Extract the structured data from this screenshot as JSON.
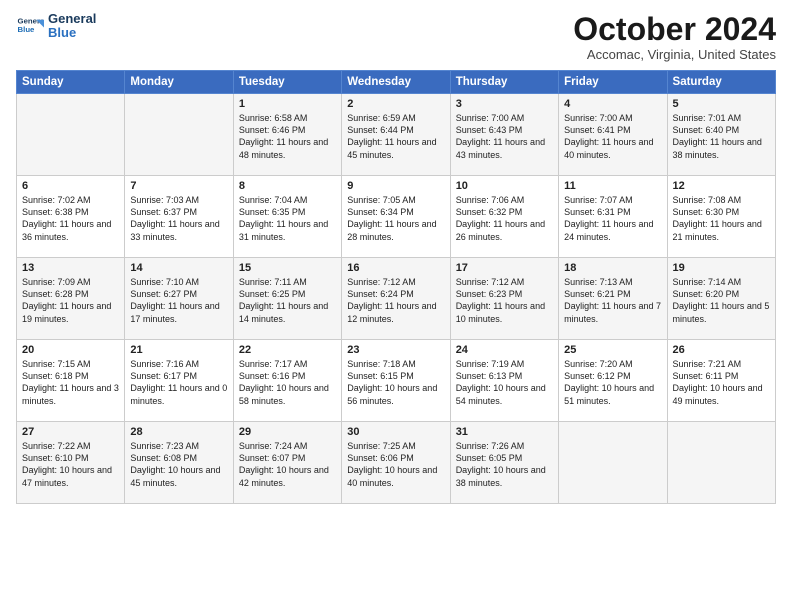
{
  "logo": {
    "line1": "General",
    "line2": "Blue"
  },
  "title": "October 2024",
  "subtitle": "Accomac, Virginia, United States",
  "days": [
    "Sunday",
    "Monday",
    "Tuesday",
    "Wednesday",
    "Thursday",
    "Friday",
    "Saturday"
  ],
  "weeks": [
    [
      {
        "day": "",
        "text": ""
      },
      {
        "day": "",
        "text": ""
      },
      {
        "day": "1",
        "text": "Sunrise: 6:58 AM\nSunset: 6:46 PM\nDaylight: 11 hours and 48 minutes."
      },
      {
        "day": "2",
        "text": "Sunrise: 6:59 AM\nSunset: 6:44 PM\nDaylight: 11 hours and 45 minutes."
      },
      {
        "day": "3",
        "text": "Sunrise: 7:00 AM\nSunset: 6:43 PM\nDaylight: 11 hours and 43 minutes."
      },
      {
        "day": "4",
        "text": "Sunrise: 7:00 AM\nSunset: 6:41 PM\nDaylight: 11 hours and 40 minutes."
      },
      {
        "day": "5",
        "text": "Sunrise: 7:01 AM\nSunset: 6:40 PM\nDaylight: 11 hours and 38 minutes."
      }
    ],
    [
      {
        "day": "6",
        "text": "Sunrise: 7:02 AM\nSunset: 6:38 PM\nDaylight: 11 hours and 36 minutes."
      },
      {
        "day": "7",
        "text": "Sunrise: 7:03 AM\nSunset: 6:37 PM\nDaylight: 11 hours and 33 minutes."
      },
      {
        "day": "8",
        "text": "Sunrise: 7:04 AM\nSunset: 6:35 PM\nDaylight: 11 hours and 31 minutes."
      },
      {
        "day": "9",
        "text": "Sunrise: 7:05 AM\nSunset: 6:34 PM\nDaylight: 11 hours and 28 minutes."
      },
      {
        "day": "10",
        "text": "Sunrise: 7:06 AM\nSunset: 6:32 PM\nDaylight: 11 hours and 26 minutes."
      },
      {
        "day": "11",
        "text": "Sunrise: 7:07 AM\nSunset: 6:31 PM\nDaylight: 11 hours and 24 minutes."
      },
      {
        "day": "12",
        "text": "Sunrise: 7:08 AM\nSunset: 6:30 PM\nDaylight: 11 hours and 21 minutes."
      }
    ],
    [
      {
        "day": "13",
        "text": "Sunrise: 7:09 AM\nSunset: 6:28 PM\nDaylight: 11 hours and 19 minutes."
      },
      {
        "day": "14",
        "text": "Sunrise: 7:10 AM\nSunset: 6:27 PM\nDaylight: 11 hours and 17 minutes."
      },
      {
        "day": "15",
        "text": "Sunrise: 7:11 AM\nSunset: 6:25 PM\nDaylight: 11 hours and 14 minutes."
      },
      {
        "day": "16",
        "text": "Sunrise: 7:12 AM\nSunset: 6:24 PM\nDaylight: 11 hours and 12 minutes."
      },
      {
        "day": "17",
        "text": "Sunrise: 7:12 AM\nSunset: 6:23 PM\nDaylight: 11 hours and 10 minutes."
      },
      {
        "day": "18",
        "text": "Sunrise: 7:13 AM\nSunset: 6:21 PM\nDaylight: 11 hours and 7 minutes."
      },
      {
        "day": "19",
        "text": "Sunrise: 7:14 AM\nSunset: 6:20 PM\nDaylight: 11 hours and 5 minutes."
      }
    ],
    [
      {
        "day": "20",
        "text": "Sunrise: 7:15 AM\nSunset: 6:18 PM\nDaylight: 11 hours and 3 minutes."
      },
      {
        "day": "21",
        "text": "Sunrise: 7:16 AM\nSunset: 6:17 PM\nDaylight: 11 hours and 0 minutes."
      },
      {
        "day": "22",
        "text": "Sunrise: 7:17 AM\nSunset: 6:16 PM\nDaylight: 10 hours and 58 minutes."
      },
      {
        "day": "23",
        "text": "Sunrise: 7:18 AM\nSunset: 6:15 PM\nDaylight: 10 hours and 56 minutes."
      },
      {
        "day": "24",
        "text": "Sunrise: 7:19 AM\nSunset: 6:13 PM\nDaylight: 10 hours and 54 minutes."
      },
      {
        "day": "25",
        "text": "Sunrise: 7:20 AM\nSunset: 6:12 PM\nDaylight: 10 hours and 51 minutes."
      },
      {
        "day": "26",
        "text": "Sunrise: 7:21 AM\nSunset: 6:11 PM\nDaylight: 10 hours and 49 minutes."
      }
    ],
    [
      {
        "day": "27",
        "text": "Sunrise: 7:22 AM\nSunset: 6:10 PM\nDaylight: 10 hours and 47 minutes."
      },
      {
        "day": "28",
        "text": "Sunrise: 7:23 AM\nSunset: 6:08 PM\nDaylight: 10 hours and 45 minutes."
      },
      {
        "day": "29",
        "text": "Sunrise: 7:24 AM\nSunset: 6:07 PM\nDaylight: 10 hours and 42 minutes."
      },
      {
        "day": "30",
        "text": "Sunrise: 7:25 AM\nSunset: 6:06 PM\nDaylight: 10 hours and 40 minutes."
      },
      {
        "day": "31",
        "text": "Sunrise: 7:26 AM\nSunset: 6:05 PM\nDaylight: 10 hours and 38 minutes."
      },
      {
        "day": "",
        "text": ""
      },
      {
        "day": "",
        "text": ""
      }
    ]
  ]
}
